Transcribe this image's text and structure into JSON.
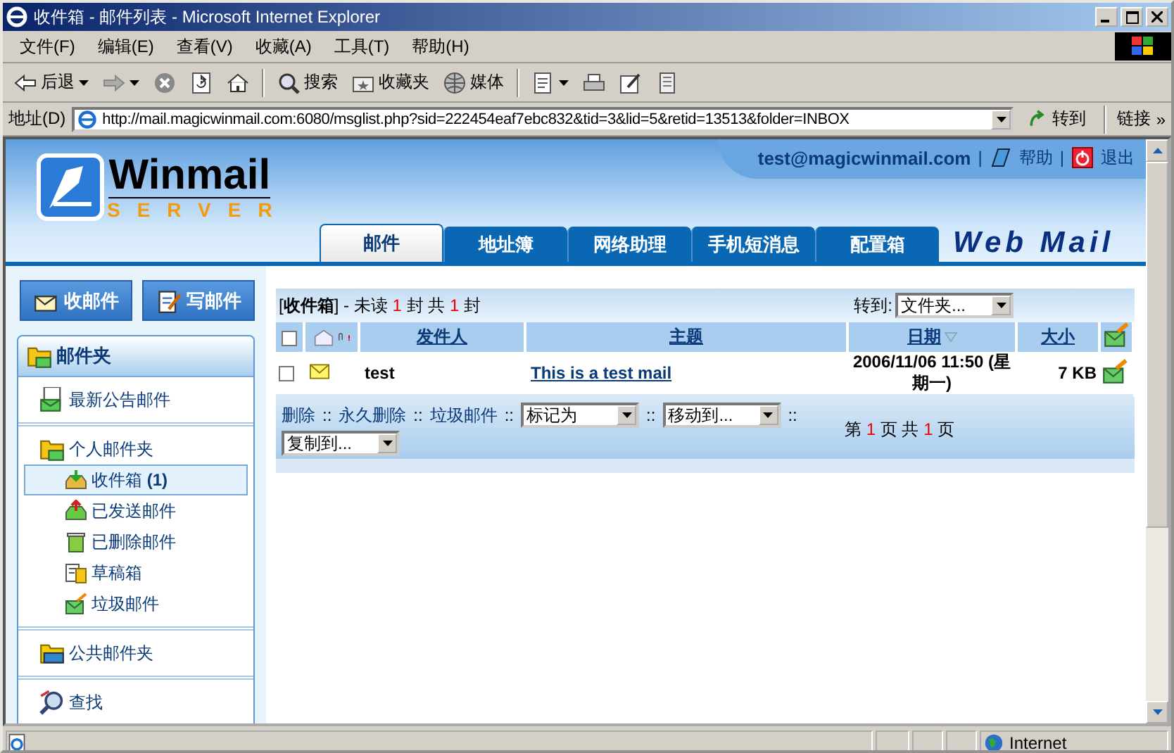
{
  "window": {
    "title": "收件箱 - 邮件列表 - Microsoft Internet Explorer"
  },
  "menu": [
    "文件(F)",
    "编辑(E)",
    "查看(V)",
    "收藏(A)",
    "工具(T)",
    "帮助(H)"
  ],
  "toolbar": [
    {
      "kind": "back",
      "label": "后退",
      "dropdown": true
    },
    {
      "kind": "forward",
      "dropdown": true
    },
    {
      "kind": "stop",
      "dropdown": false
    },
    {
      "kind": "refresh",
      "dropdown": false
    },
    {
      "kind": "home",
      "dropdown": false
    },
    {
      "kind": "search",
      "label": "搜索",
      "dropdown": false
    },
    {
      "kind": "favorites",
      "label": "收藏夹",
      "dropdown": false
    },
    {
      "kind": "media",
      "label": "媒体",
      "dropdown": false
    },
    {
      "kind": "mail",
      "dropdown": true
    },
    {
      "kind": "print",
      "dropdown": false
    },
    {
      "kind": "edit",
      "dropdown": false
    },
    {
      "kind": "discuss",
      "dropdown": false
    }
  ],
  "address": {
    "label": "地址(D)",
    "url": "http://mail.magicwinmail.com:6080/msglist.php?sid=222454eaf7ebc832&tid=3&lid=5&retid=13513&folder=INBOX",
    "go": "转到",
    "links": "链接",
    "links_more": "»"
  },
  "header": {
    "logo": "Winmail",
    "logo_sub": "SERVER",
    "user": "test@magicwinmail.com",
    "sep": "|",
    "help": "帮助",
    "logout": "退出",
    "brand": "Web Mail"
  },
  "tabs": [
    {
      "label": "邮件",
      "selected": true
    },
    {
      "label": "地址簿",
      "selected": false
    },
    {
      "label": "网络助理",
      "selected": false
    },
    {
      "label": "手机短消息",
      "selected": false
    },
    {
      "label": "配置箱",
      "selected": false
    }
  ],
  "sidebar": {
    "buttons": [
      {
        "kind": "receive",
        "label": "收邮件"
      },
      {
        "kind": "compose",
        "label": "写邮件"
      }
    ],
    "panel_title": "邮件夹",
    "sections": [
      {
        "items": [
          {
            "kind": "notice",
            "label": "最新公告邮件",
            "selected": false
          }
        ]
      },
      {
        "items": [
          {
            "kind": "folder",
            "label": "个人邮件夹",
            "selected": false,
            "children": [
              {
                "kind": "inbox",
                "label": "收件箱 **(1)**",
                "selected": true
              },
              {
                "kind": "sent",
                "label": "已发送邮件",
                "selected": false
              },
              {
                "kind": "trash",
                "label": "已删除邮件",
                "selected": false
              },
              {
                "kind": "drafts",
                "label": "草稿箱",
                "selected": false
              },
              {
                "kind": "junk",
                "label": "垃圾邮件",
                "selected": false
              }
            ]
          }
        ]
      },
      {
        "items": [
          {
            "kind": "public",
            "label": "公共邮件夹",
            "selected": false
          }
        ]
      },
      {
        "items": [
          {
            "kind": "search",
            "label": "查找",
            "selected": false
          }
        ]
      }
    ]
  },
  "list": {
    "summary": {
      "folder": "[**收件箱**]",
      "unread_label": "- 未读",
      "unread": "1",
      "unit": "封",
      "total_label": "共",
      "total": "1",
      "unit2": "封"
    },
    "goto_label": "转到:",
    "goto_select": "文件夹...",
    "header_checkbox": {
      "checked": false
    },
    "columns": [
      {
        "label": "发件人",
        "sorted": false
      },
      {
        "label": "主题",
        "sorted": false
      },
      {
        "label": "日期",
        "sorted": true
      },
      {
        "label": "大小",
        "sorted": false
      }
    ],
    "rows": [
      {
        "checked": false,
        "unread": true,
        "from": "test",
        "subject": "This is a test mail",
        "date": "2006/11/06 11:50 (星期一)",
        "size": "7 KB"
      }
    ],
    "actions": [
      {
        "kind": "link",
        "label": "删除"
      },
      {
        "kind": "sep",
        "label": "::"
      },
      {
        "kind": "link",
        "label": "永久删除"
      },
      {
        "kind": "sep",
        "label": "::"
      },
      {
        "kind": "link",
        "label": "垃圾邮件"
      },
      {
        "kind": "sep",
        "label": "::"
      },
      {
        "kind": "select",
        "label": "标记为"
      },
      {
        "kind": "sep",
        "label": "::"
      },
      {
        "kind": "select",
        "label": "移动到..."
      },
      {
        "kind": "sep",
        "label": "::"
      },
      {
        "kind": "select",
        "label": "复制到..."
      }
    ],
    "pager": {
      "prefix": "第",
      "page": "1",
      "mid": "页 共",
      "pages": "1",
      "suffix": "页"
    }
  },
  "status": {
    "zone": "Internet"
  }
}
